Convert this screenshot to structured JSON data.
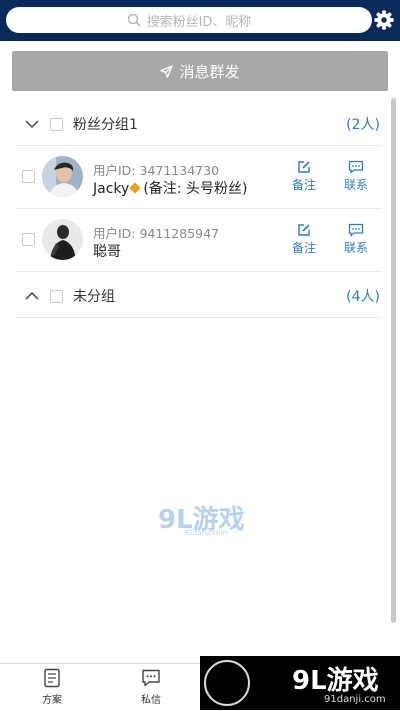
{
  "search": {
    "placeholder": "搜索粉丝ID、昵称"
  },
  "broadcast": {
    "label": "消息群发"
  },
  "groups": [
    {
      "name": "粉丝分组1",
      "count": "(2人)",
      "expanded": true,
      "members": [
        {
          "user_id": "用户ID: 3471134730",
          "name": "Jacky",
          "note": "(备注: 头号粉丝)",
          "remark_label": "备注",
          "contact_label": "联系"
        },
        {
          "user_id": "用户ID: 9411285947",
          "name": "聪哥",
          "note": "",
          "remark_label": "备注",
          "contact_label": "联系"
        }
      ]
    },
    {
      "name": "未分组",
      "count": "(4人)",
      "expanded": false
    }
  ],
  "bottom_nav": [
    {
      "label": "方案",
      "icon": "document-icon"
    },
    {
      "label": "私信",
      "icon": "chat-icon"
    }
  ],
  "watermark": {
    "main": "9L游戏",
    "sub": "91danji.com"
  },
  "footer_logo": {
    "main": "9L游戏",
    "sub": "91danji.com"
  },
  "colors": {
    "topbar": "#0b2a5c",
    "accent": "#2f7cc2",
    "broadcast_button": "#a8a8a8"
  }
}
